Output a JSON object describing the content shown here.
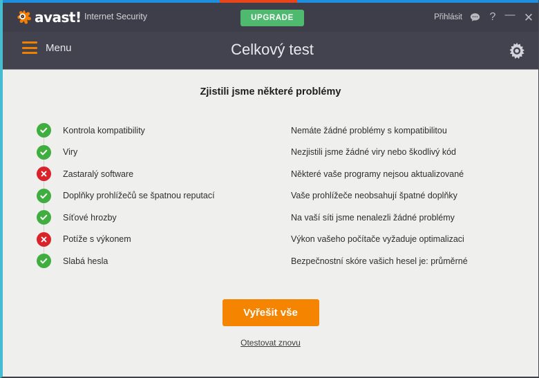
{
  "window": {
    "accent_blue": "#1f8fdd",
    "accent_orange": "#e8461a",
    "header_bg": "#3e3e4a",
    "subheader_bg": "#43434f",
    "body_bg": "#efefee",
    "border_teal": "#45bcd2"
  },
  "header": {
    "brand": "avast!",
    "product": "Internet Security",
    "upgrade_label": "UPGRADE",
    "signin_label": "Přihlásit",
    "icons": {
      "chat": "chat-bubble-icon",
      "help": "?",
      "minimize": "—",
      "close": "✕"
    },
    "upgrade_color": "#4fba6f"
  },
  "subheader": {
    "menu_label": "Menu",
    "page_title": "Celkový test",
    "menu_icon": "hamburger-icon",
    "settings_icon": "gear-icon",
    "menu_icon_color": "#f08000"
  },
  "main": {
    "result_heading": "Zjistili jsme některé problémy",
    "rows": [
      {
        "status": "ok",
        "label": "Kontrola kompatibility",
        "description": "Nemáte žádné problémy s kompatibilitou",
        "icon": "check-circle-icon"
      },
      {
        "status": "ok",
        "label": "Viry",
        "description": "Nezjistili jsme žádné viry nebo škodlivý kód",
        "icon": "check-circle-icon"
      },
      {
        "status": "bad",
        "label": "Zastaralý software",
        "description": "Některé vaše programy nejsou aktualizované",
        "icon": "x-circle-icon"
      },
      {
        "status": "ok",
        "label": "Doplňky prohlížečů se špatnou reputací",
        "description": "Vaše prohlížeče neobsahují špatné doplňky",
        "icon": "check-circle-icon"
      },
      {
        "status": "ok",
        "label": "Síťové hrozby",
        "description": "Na vaší síti jsme nenalezli žádné problémy",
        "icon": "check-circle-icon"
      },
      {
        "status": "bad",
        "label": "Potíže s výkonem",
        "description": "Výkon vašeho počítače vyžaduje optimalizaci",
        "icon": "x-circle-icon"
      },
      {
        "status": "ok",
        "label": "Slabá hesla",
        "description": "Bezpečnostní skóre vašich hesel je: průměrné",
        "icon": "check-circle-icon"
      }
    ],
    "resolve_label": "Vyřešit vše",
    "retest_label": "Otestovat znovu",
    "resolve_color": "#f58400",
    "ok_color": "#3fae3f",
    "bad_color": "#d9222a"
  }
}
